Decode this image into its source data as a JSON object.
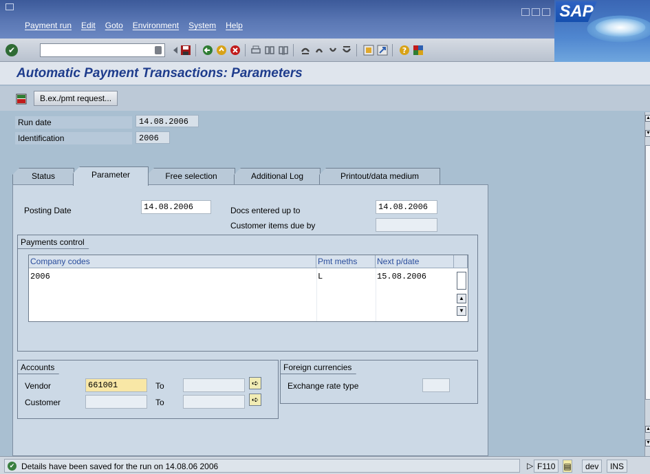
{
  "menu": {
    "items": [
      "Payment run",
      "Edit",
      "Goto",
      "Environment",
      "System",
      "Help"
    ]
  },
  "brand": {
    "logo_text": "SAP"
  },
  "page": {
    "title": "Automatic Payment Transactions: Parameters"
  },
  "app_toolbar": {
    "button_label": "B.ex./pmt request..."
  },
  "header": {
    "run_date_label": "Run date",
    "run_date_value": "14.08.2006",
    "identification_label": "Identification",
    "identification_value": "2006"
  },
  "tabs": [
    {
      "label": "Status"
    },
    {
      "label": "Parameter"
    },
    {
      "label": "Free selection"
    },
    {
      "label": "Additional Log"
    },
    {
      "label": "Printout/data medium"
    }
  ],
  "parameters": {
    "posting_date_label": "Posting Date",
    "posting_date_value": "14.08.2006",
    "docs_entered_label": "Docs entered up to",
    "docs_entered_value": "14.08.2006",
    "customer_due_label": "Customer items due by",
    "customer_due_value": ""
  },
  "payments_control": {
    "title": "Payments control",
    "columns": [
      "Company codes",
      "Pmt meths",
      "Next p/date"
    ],
    "rows": [
      {
        "company_codes": "2006",
        "pmt_meths": "L",
        "next_pdate": "15.08.2006"
      }
    ]
  },
  "accounts": {
    "title": "Accounts",
    "vendor_label": "Vendor",
    "vendor_value": "661001",
    "vendor_to_label": "To",
    "vendor_to_value": "",
    "customer_label": "Customer",
    "customer_value": "",
    "customer_to_label": "To",
    "customer_to_value": ""
  },
  "foreign_currencies": {
    "title": "Foreign currencies",
    "exchange_rate_label": "Exchange rate type",
    "exchange_rate_value": ""
  },
  "status": {
    "message": "Details have been saved for the run on 14.08.06 2006",
    "transaction": "F110",
    "system": "dev",
    "mode": "INS"
  }
}
